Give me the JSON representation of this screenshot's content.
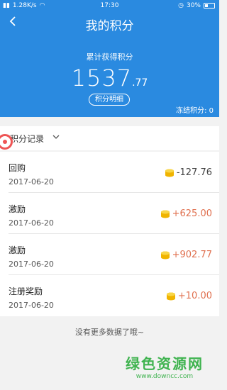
{
  "status_bar": {
    "signal_text": "1.28K/s",
    "time": "17:30",
    "battery": "30%"
  },
  "header": {
    "title": "我的积分",
    "total_label": "累计获得积分",
    "total_int": "1537",
    "total_dec": ".77",
    "detail_button": "积分明细",
    "frozen": "冻结积分: 0"
  },
  "filter": {
    "label": "积分记录"
  },
  "records": [
    {
      "title": "回购",
      "date": "2017-06-20",
      "amount": "-127.76",
      "sign": "neg"
    },
    {
      "title": "激励",
      "date": "2017-06-20",
      "amount": "+625.00",
      "sign": "pos"
    },
    {
      "title": "激励",
      "date": "2017-06-20",
      "amount": "+902.77",
      "sign": "pos"
    },
    {
      "title": "注册奖励",
      "date": "2017-06-20",
      "amount": "+10.00",
      "sign": "pos"
    }
  ],
  "footer": {
    "no_more": "没有更多数据了哦~"
  },
  "watermark": {
    "big": "绿色资源网",
    "small": "www.downcc.com"
  },
  "colors": {
    "header_bg": "#2a8ae0",
    "positive": "#e0704f",
    "coin": "#f5c518"
  }
}
